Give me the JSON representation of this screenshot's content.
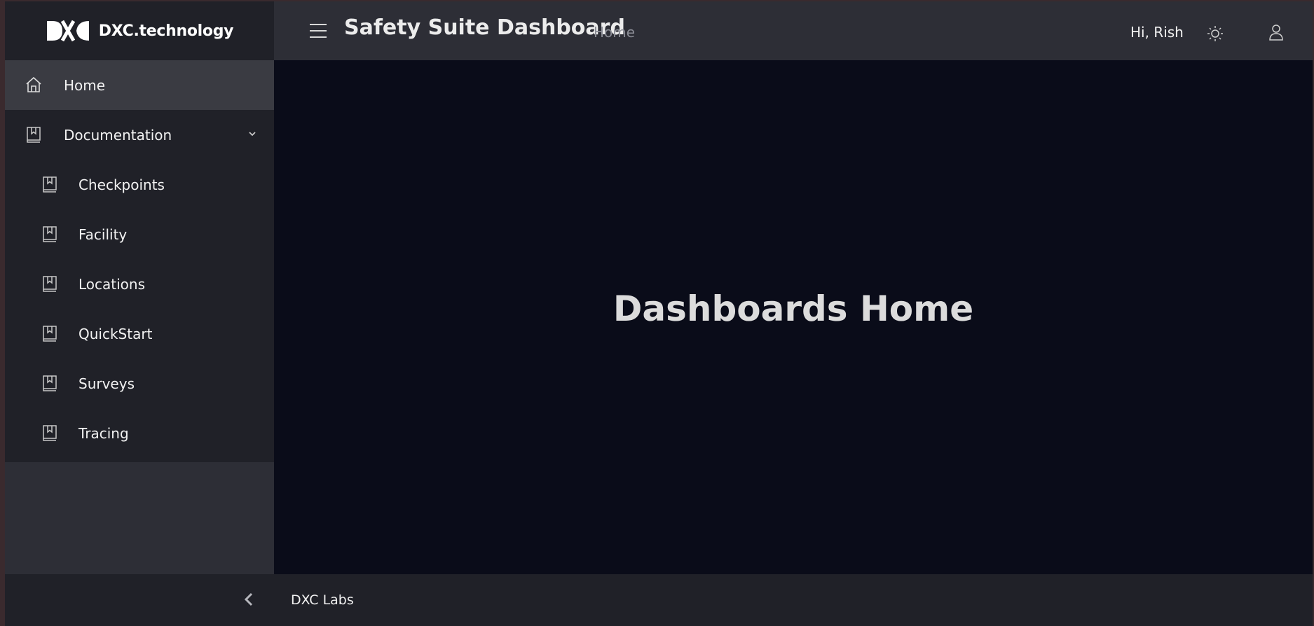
{
  "brand": {
    "logo_text": "DXC.technology"
  },
  "header": {
    "title": "Safety Suite Dashboard",
    "breadcrumb": "Home",
    "greeting": "Hi, Rish"
  },
  "sidebar": {
    "items": [
      {
        "label": "Home",
        "icon": "home-icon",
        "active": true
      },
      {
        "label": "Documentation",
        "icon": "book-icon",
        "expanded": true,
        "children": [
          {
            "label": "Checkpoints",
            "icon": "book-icon"
          },
          {
            "label": "Facility",
            "icon": "book-icon"
          },
          {
            "label": "Locations",
            "icon": "book-icon"
          },
          {
            "label": "QuickStart",
            "icon": "book-icon"
          },
          {
            "label": "Surveys",
            "icon": "book-icon"
          },
          {
            "label": "Tracing",
            "icon": "book-icon"
          }
        ]
      }
    ]
  },
  "main": {
    "title": "Dashboards Home"
  },
  "footer": {
    "text": "DXC Labs"
  },
  "colors": {
    "sidebar_bg": "#202128",
    "header_bg": "#2d2e36",
    "main_bg": "#0a0c19",
    "active_item_bg": "#3a3b42"
  }
}
